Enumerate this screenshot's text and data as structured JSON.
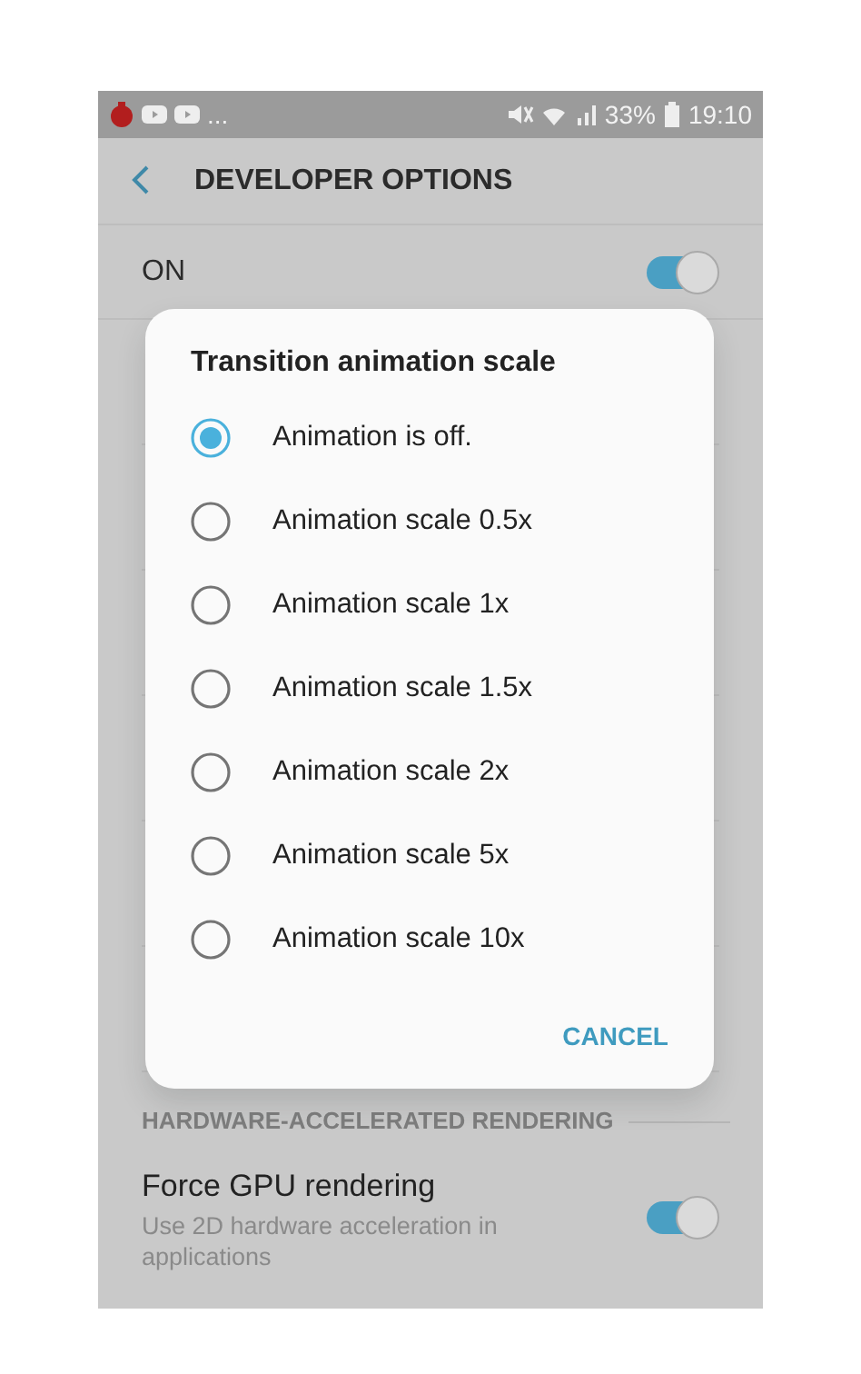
{
  "status_bar": {
    "notifications": "...",
    "battery": "33%",
    "time": "19:10"
  },
  "header": {
    "title": "DEVELOPER OPTIONS"
  },
  "master_switch": {
    "label": "ON",
    "on": true
  },
  "dialog": {
    "title": "Transition animation scale",
    "options": [
      {
        "label": "Animation is off.",
        "selected": true
      },
      {
        "label": "Animation scale 0.5x",
        "selected": false
      },
      {
        "label": "Animation scale 1x",
        "selected": false
      },
      {
        "label": "Animation scale 1.5x",
        "selected": false
      },
      {
        "label": "Animation scale 2x",
        "selected": false
      },
      {
        "label": "Animation scale 5x",
        "selected": false
      },
      {
        "label": "Animation scale 10x",
        "selected": false
      }
    ],
    "button": "CANCEL"
  },
  "section": {
    "title": "HARDWARE-ACCELERATED RENDERING"
  },
  "settings": [
    {
      "title": "Force GPU rendering",
      "summary": "Use 2D hardware acceleration in applications",
      "on": true
    }
  ]
}
